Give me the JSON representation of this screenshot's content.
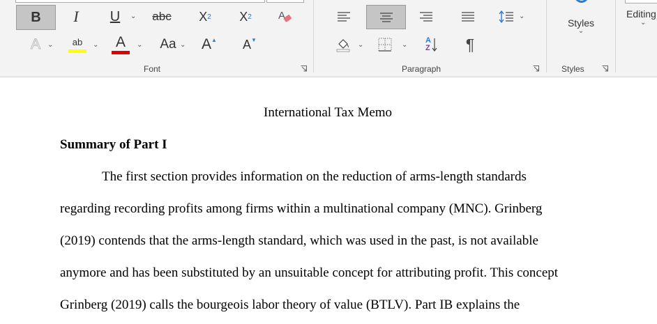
{
  "ribbon": {
    "font_group": {
      "label": "Font",
      "bold": "B",
      "italic": "I",
      "underline": "U",
      "strikethrough": "abc",
      "subscript": "X",
      "subscript_mark": "2",
      "superscript": "X",
      "superscript_mark": "2",
      "highlight_text": "ab",
      "change_case": "Aa",
      "grow_font": "A",
      "shrink_font": "A",
      "highlight_color": "#ffff00",
      "font_color": "#e00000"
    },
    "paragraph_group": {
      "label": "Paragraph",
      "pilcrow": "¶",
      "sort_a": "A",
      "sort_z": "Z"
    },
    "styles_group": {
      "label": "Styles",
      "button": "Styles"
    },
    "editing_group": {
      "button": "Editing"
    }
  },
  "document": {
    "title": "International Tax Memo",
    "heading": "Summary of Part I",
    "lines": [
      "The first section provides information on the reduction of arms-length standards",
      "regarding recording profits among firms within a multinational company (MNC). Grinberg",
      "(2019) contends that the arms-length standard, which was used in the past, is not available",
      "anymore and has been substituted by an unsuitable concept for attributing profit. This concept",
      "Grinberg (2019) calls the bourgeois labor theory of value (BTLV). Part IB explains the"
    ]
  }
}
